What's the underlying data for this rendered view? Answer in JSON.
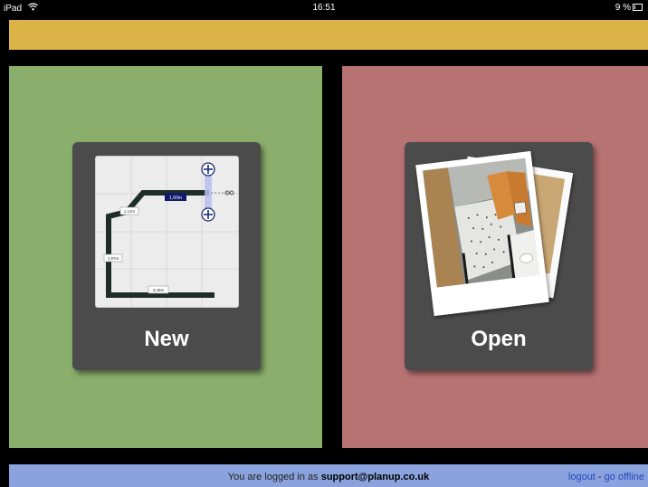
{
  "status_bar": {
    "device": "iPad",
    "time": "16:51",
    "battery": "9 %"
  },
  "main": {
    "new_label": "New",
    "open_label": "Open",
    "plan_dimensions": [
      "1,60m",
      "1,14m",
      "1,97m",
      "3,48m"
    ]
  },
  "footer": {
    "message_prefix": "You are logged in as",
    "email": "support@planup.co.uk",
    "logout": "logout",
    "separator": "-",
    "go_offline": "go offline"
  },
  "colors": {
    "top_bar": "#dcb347",
    "new_panel": "#8aae6b",
    "open_panel": "#b77272",
    "bottom_bar": "#8aa3de",
    "card": "#4b4b4b"
  }
}
